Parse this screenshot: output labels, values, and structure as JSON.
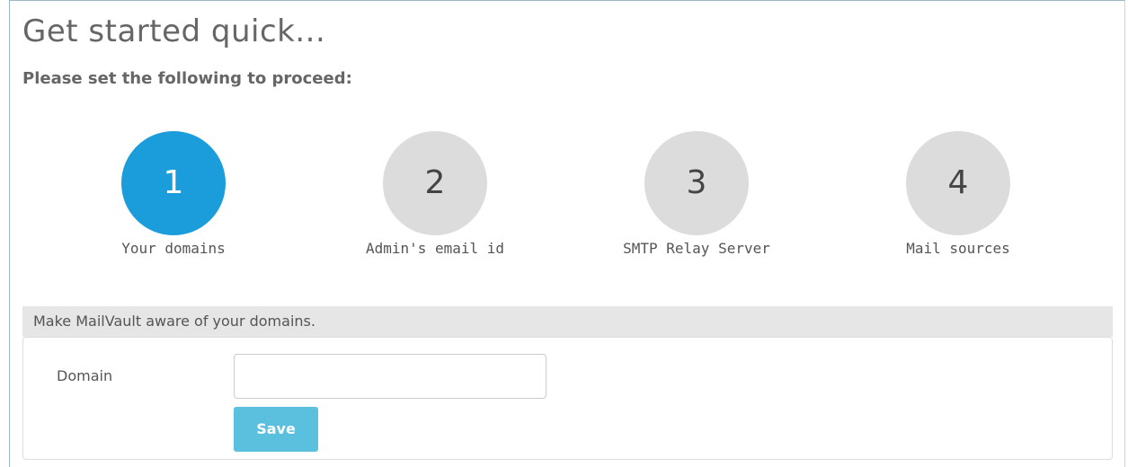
{
  "page": {
    "title": "Get started quick...",
    "subtitle": "Please set the following to proceed:"
  },
  "steps": [
    {
      "number": "1",
      "label": "Your domains",
      "active": true
    },
    {
      "number": "2",
      "label": "Admin's email id",
      "active": false
    },
    {
      "number": "3",
      "label": "SMTP Relay Server",
      "active": false
    },
    {
      "number": "4",
      "label": "Mail sources",
      "active": false
    }
  ],
  "panel": {
    "header": "Make MailVault aware of your domains.",
    "domain_label": "Domain",
    "domain_value": "",
    "domain_placeholder": "",
    "save_label": "Save"
  },
  "colors": {
    "active_step": "#1b9ddb",
    "inactive_step": "#dcdcdc",
    "save_button": "#5bc0de",
    "panel_header_bg": "#e6e6e6"
  }
}
